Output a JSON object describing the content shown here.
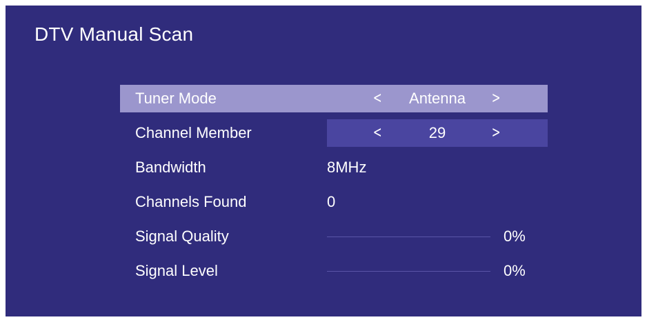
{
  "title": "DTV Manual Scan",
  "menu": {
    "tuner_mode": {
      "label": "Tuner Mode",
      "value": "Antenna",
      "prev_glyph": "<",
      "next_glyph": ">"
    },
    "channel_member": {
      "label": "Channel Member",
      "value": "29",
      "prev_glyph": "<",
      "next_glyph": ">"
    },
    "bandwidth": {
      "label": "Bandwidth",
      "value": "8MHz"
    },
    "channels_found": {
      "label": "Channels Found",
      "value": "0"
    },
    "signal_quality": {
      "label": "Signal Quality",
      "level": 0,
      "percent_text": "0%"
    },
    "signal_level": {
      "label": "Signal Level",
      "level": 0,
      "percent_text": "0%"
    }
  },
  "colors": {
    "background": "#302c7c",
    "highlight_row": "#9b96cd",
    "selector_box": "#4a45a0",
    "text": "#ffffff"
  }
}
